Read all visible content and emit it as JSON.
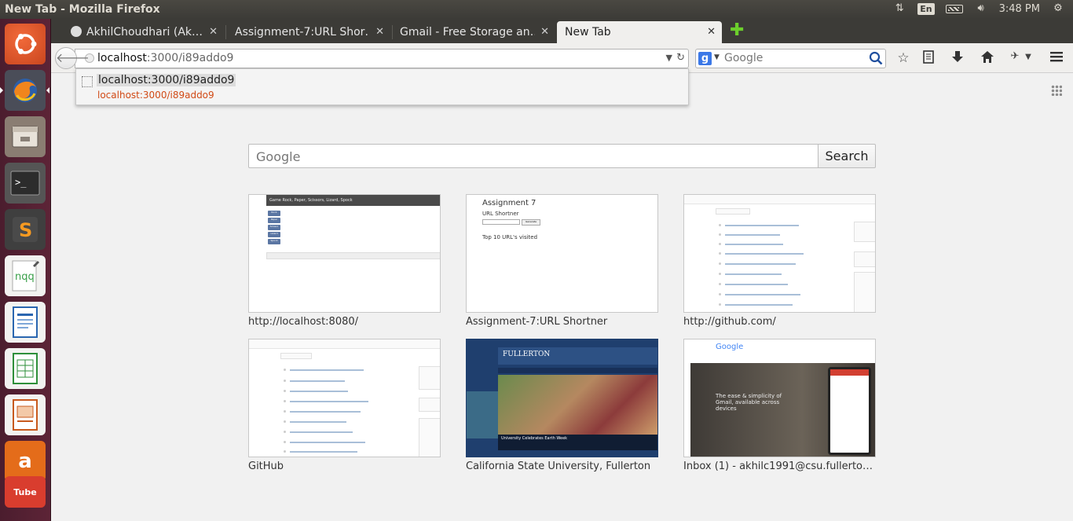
{
  "top_panel": {
    "window_title": "New Tab - Mozilla Firefox",
    "keyboard_layout": "En",
    "clock": "3:48 PM"
  },
  "launcher": {
    "items": [
      "ubuntu-dash",
      "firefox",
      "files",
      "terminal",
      "sublime-text",
      "nqq-editor",
      "libreoffice-writer",
      "libreoffice-calc",
      "libreoffice-impress",
      "amazon",
      "youtube"
    ]
  },
  "tabs": [
    {
      "label": "AkhilChoudhari (Ak…",
      "active": false
    },
    {
      "label": "Assignment-7:URL Shor…",
      "active": false
    },
    {
      "label": "Gmail - Free Storage an…",
      "active": false
    },
    {
      "label": "New Tab",
      "active": true
    }
  ],
  "navbar": {
    "url_host": "localhost",
    "url_path": ":3000/i89addo9",
    "search_placeholder": "Google"
  },
  "autocomplete": {
    "title": "localhost:3000/i89addo9",
    "url": "localhost:3000/i89addo9"
  },
  "newtab": {
    "search_placeholder": "Google",
    "search_button": "Search",
    "tiles": [
      {
        "caption": "http://localhost:8080/"
      },
      {
        "caption": "Assignment-7:URL Shortner"
      },
      {
        "caption": "http://github.com/"
      },
      {
        "caption": "GitHub"
      },
      {
        "caption": "California State University, Fullerton"
      },
      {
        "caption": "Inbox (1) - akhilc1991@csu.fullerto…"
      }
    ],
    "thumb_text": {
      "rps_header": "Game Rock, Paper, Scissors, Lizard, Spock",
      "rps_buttons": [
        "Rock",
        "Paper",
        "Scissor",
        "Lizard",
        "Spock"
      ],
      "a7_title": "Assignment 7",
      "a7_sub": "URL Shortner",
      "a7_button": "Generate",
      "a7_top": "Top 10 URL's visited",
      "csuf_name": "FULLERTON",
      "csuf_caption": "University Celebrates Earth Week",
      "gmail_logo": "Google",
      "gmail_text": "The ease & simplicity of Gmail, available across devices"
    }
  },
  "colors": {
    "launcher_bg": "#5d2437",
    "panel_bg": "#3c3b37",
    "autocomplete_url": "#d14a15",
    "newtab_add": "#6ccf2c"
  }
}
